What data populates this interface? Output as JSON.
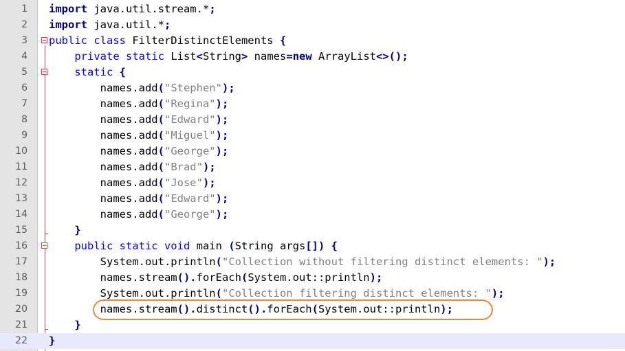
{
  "editor": {
    "accent_colors": {
      "keyword": "#0000ff",
      "keyword_bold": "#000080",
      "string": "#808080",
      "fold_marker": "#d84040",
      "highlight_ellipse": "#e8893a",
      "current_line": "#e8e8ff"
    },
    "current_line_number": "22",
    "lines": [
      {
        "n": "1",
        "tokens": [
          [
            "kwb",
            "import"
          ],
          [
            "p",
            " java.util.stream.*"
          ],
          [
            "op",
            ";"
          ]
        ]
      },
      {
        "n": "2",
        "tokens": [
          [
            "kwb",
            "import"
          ],
          [
            "p",
            " java.util.*"
          ],
          [
            "op",
            ";"
          ]
        ]
      },
      {
        "n": "3",
        "tokens": [
          [
            "kw",
            "public class"
          ],
          [
            "p",
            " FilterDistinctElements "
          ],
          [
            "op",
            "{"
          ]
        ]
      },
      {
        "n": "4",
        "tokens": [
          [
            "p",
            "    "
          ],
          [
            "kw",
            "private static"
          ],
          [
            "p",
            " List"
          ],
          [
            "op",
            "<"
          ],
          [
            "p",
            "String"
          ],
          [
            "op",
            ">"
          ],
          [
            "p",
            " names"
          ],
          [
            "op",
            "="
          ],
          [
            "kwb",
            "new"
          ],
          [
            "p",
            " ArrayList"
          ],
          [
            "op",
            "<>();"
          ]
        ]
      },
      {
        "n": "5",
        "tokens": [
          [
            "p",
            "    "
          ],
          [
            "kw",
            "static"
          ],
          [
            "p",
            " "
          ],
          [
            "op",
            "{"
          ]
        ]
      },
      {
        "n": "6",
        "tokens": [
          [
            "p",
            "        names.add"
          ],
          [
            "op",
            "("
          ],
          [
            "str",
            "\"Stephen\""
          ],
          [
            "op",
            ");"
          ]
        ]
      },
      {
        "n": "7",
        "tokens": [
          [
            "p",
            "        names.add"
          ],
          [
            "op",
            "("
          ],
          [
            "str",
            "\"Regina\""
          ],
          [
            "op",
            ");"
          ]
        ]
      },
      {
        "n": "8",
        "tokens": [
          [
            "p",
            "        names.add"
          ],
          [
            "op",
            "("
          ],
          [
            "str",
            "\"Edward\""
          ],
          [
            "op",
            ");"
          ]
        ]
      },
      {
        "n": "9",
        "tokens": [
          [
            "p",
            "        names.add"
          ],
          [
            "op",
            "("
          ],
          [
            "str",
            "\"Miguel\""
          ],
          [
            "op",
            ");"
          ]
        ]
      },
      {
        "n": "10",
        "tokens": [
          [
            "p",
            "        names.add"
          ],
          [
            "op",
            "("
          ],
          [
            "str",
            "\"George\""
          ],
          [
            "op",
            ");"
          ]
        ]
      },
      {
        "n": "11",
        "tokens": [
          [
            "p",
            "        names.add"
          ],
          [
            "op",
            "("
          ],
          [
            "str",
            "\"Brad\""
          ],
          [
            "op",
            ");"
          ]
        ]
      },
      {
        "n": "12",
        "tokens": [
          [
            "p",
            "        names.add"
          ],
          [
            "op",
            "("
          ],
          [
            "str",
            "\"Jose\""
          ],
          [
            "op",
            ");"
          ]
        ]
      },
      {
        "n": "13",
        "tokens": [
          [
            "p",
            "        names.add"
          ],
          [
            "op",
            "("
          ],
          [
            "str",
            "\"Edward\""
          ],
          [
            "op",
            ");"
          ]
        ]
      },
      {
        "n": "14",
        "tokens": [
          [
            "p",
            "        names.add"
          ],
          [
            "op",
            "("
          ],
          [
            "str",
            "\"George\""
          ],
          [
            "op",
            ");"
          ]
        ]
      },
      {
        "n": "15",
        "tokens": [
          [
            "p",
            "    "
          ],
          [
            "op",
            "}"
          ]
        ]
      },
      {
        "n": "16",
        "tokens": [
          [
            "p",
            "    "
          ],
          [
            "kw",
            "public static void"
          ],
          [
            "p",
            " main "
          ],
          [
            "op",
            "("
          ],
          [
            "p",
            "String args"
          ],
          [
            "op",
            "[])"
          ],
          [
            "p",
            " "
          ],
          [
            "op",
            "{"
          ]
        ]
      },
      {
        "n": "17",
        "tokens": [
          [
            "p",
            "        System.out.println"
          ],
          [
            "op",
            "("
          ],
          [
            "str",
            "\"Collection without filtering distinct elements: \""
          ],
          [
            "op",
            ");"
          ]
        ]
      },
      {
        "n": "18",
        "tokens": [
          [
            "p",
            "        names.stream"
          ],
          [
            "op",
            "()."
          ],
          [
            "p",
            "forEach"
          ],
          [
            "op",
            "("
          ],
          [
            "p",
            "System.out::println"
          ],
          [
            "op",
            ");"
          ]
        ]
      },
      {
        "n": "19",
        "tokens": [
          [
            "p",
            "        System.out.println"
          ],
          [
            "op",
            "("
          ],
          [
            "str",
            "\"Collection filtering distinct elements: \""
          ],
          [
            "op",
            ");"
          ]
        ]
      },
      {
        "n": "20",
        "tokens": [
          [
            "p",
            "        names.stream"
          ],
          [
            "op",
            "()."
          ],
          [
            "p",
            "distinct"
          ],
          [
            "op",
            "()."
          ],
          [
            "p",
            "forEach"
          ],
          [
            "op",
            "("
          ],
          [
            "p",
            "System.out::println"
          ],
          [
            "op",
            ");"
          ]
        ]
      },
      {
        "n": "21",
        "tokens": [
          [
            "p",
            "    "
          ],
          [
            "op",
            "}"
          ]
        ]
      },
      {
        "n": "22",
        "tokens": [
          [
            "op",
            "}"
          ]
        ]
      }
    ],
    "highlighted_line": "20"
  }
}
